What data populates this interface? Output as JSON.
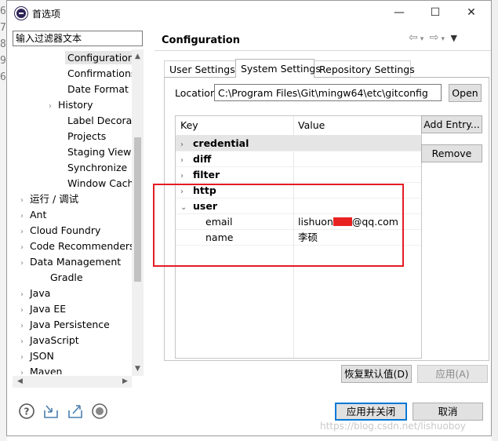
{
  "window": {
    "title": "首选项",
    "controls": [
      "—",
      "☐",
      "✕"
    ]
  },
  "background_gutter": [
    "6",
    "7",
    "8",
    "9",
    "6"
  ],
  "filter": {
    "placeholder": "输入过滤器文本"
  },
  "tree": [
    {
      "label": "Configuration",
      "indent": 3,
      "arrow": "",
      "selected": true
    },
    {
      "label": "Confirmations ar",
      "indent": 3,
      "arrow": ""
    },
    {
      "label": "Date Format",
      "indent": 3,
      "arrow": ""
    },
    {
      "label": "History",
      "indent": 2,
      "arrow": "›"
    },
    {
      "label": "Label Decoration",
      "indent": 3,
      "arrow": ""
    },
    {
      "label": "Projects",
      "indent": 3,
      "arrow": ""
    },
    {
      "label": "Staging View",
      "indent": 3,
      "arrow": ""
    },
    {
      "label": "Synchronize",
      "indent": 3,
      "arrow": ""
    },
    {
      "label": "Window Cache",
      "indent": 3,
      "arrow": ""
    },
    {
      "label": "运行 / 调试",
      "indent": 0,
      "arrow": "›"
    },
    {
      "label": "Ant",
      "indent": 0,
      "arrow": "›"
    },
    {
      "label": "Cloud Foundry",
      "indent": 0,
      "arrow": "›"
    },
    {
      "label": "Code Recommenders",
      "indent": 0,
      "arrow": "›"
    },
    {
      "label": "Data Management",
      "indent": 0,
      "arrow": "›"
    },
    {
      "label": "Gradle",
      "indent": 1,
      "arrow": ""
    },
    {
      "label": "Java",
      "indent": 0,
      "arrow": "›"
    },
    {
      "label": "Java EE",
      "indent": 0,
      "arrow": "›"
    },
    {
      "label": "Java Persistence",
      "indent": 0,
      "arrow": "›"
    },
    {
      "label": "JavaScript",
      "indent": 0,
      "arrow": "›"
    },
    {
      "label": "JSON",
      "indent": 0,
      "arrow": "›"
    },
    {
      "label": "Maven",
      "indent": 0,
      "arrow": "›"
    }
  ],
  "page": {
    "title": "Configuration"
  },
  "tabs": [
    "User Settings",
    "System Settings",
    "Repository Settings"
  ],
  "active_tab": 1,
  "location": {
    "label": "Location:",
    "value": "C:\\Program Files\\Git\\mingw64\\etc\\gitconfig",
    "open_label": "Open"
  },
  "table": {
    "headers": [
      "Key",
      "Value"
    ],
    "rows": [
      {
        "key": "credential",
        "value": "",
        "bold": true,
        "arrow": "›",
        "selected": true
      },
      {
        "key": "diff",
        "value": "",
        "bold": true,
        "arrow": "›"
      },
      {
        "key": "filter",
        "value": "",
        "bold": true,
        "arrow": "›"
      },
      {
        "key": "http",
        "value": "",
        "bold": true,
        "arrow": "›"
      },
      {
        "key": "user",
        "value": "",
        "bold": true,
        "arrow": "⌄"
      },
      {
        "key": "email",
        "value_pre": "lishuon",
        "value_post": "@qq.com",
        "child": true,
        "redacted": true
      },
      {
        "key": "name",
        "value": "李硕",
        "child": true
      }
    ]
  },
  "buttons": {
    "add_entry": "Add Entry...",
    "remove": "Remove",
    "restore_defaults": "恢复默认值(D)",
    "apply": "应用(A)",
    "apply_close": "应用并关闭",
    "cancel": "取消"
  },
  "watermark": "https://blog.csdn.net/lishuoboy",
  "colors": {
    "highlight": "#e31c23",
    "primary_border": "#0078d7"
  }
}
